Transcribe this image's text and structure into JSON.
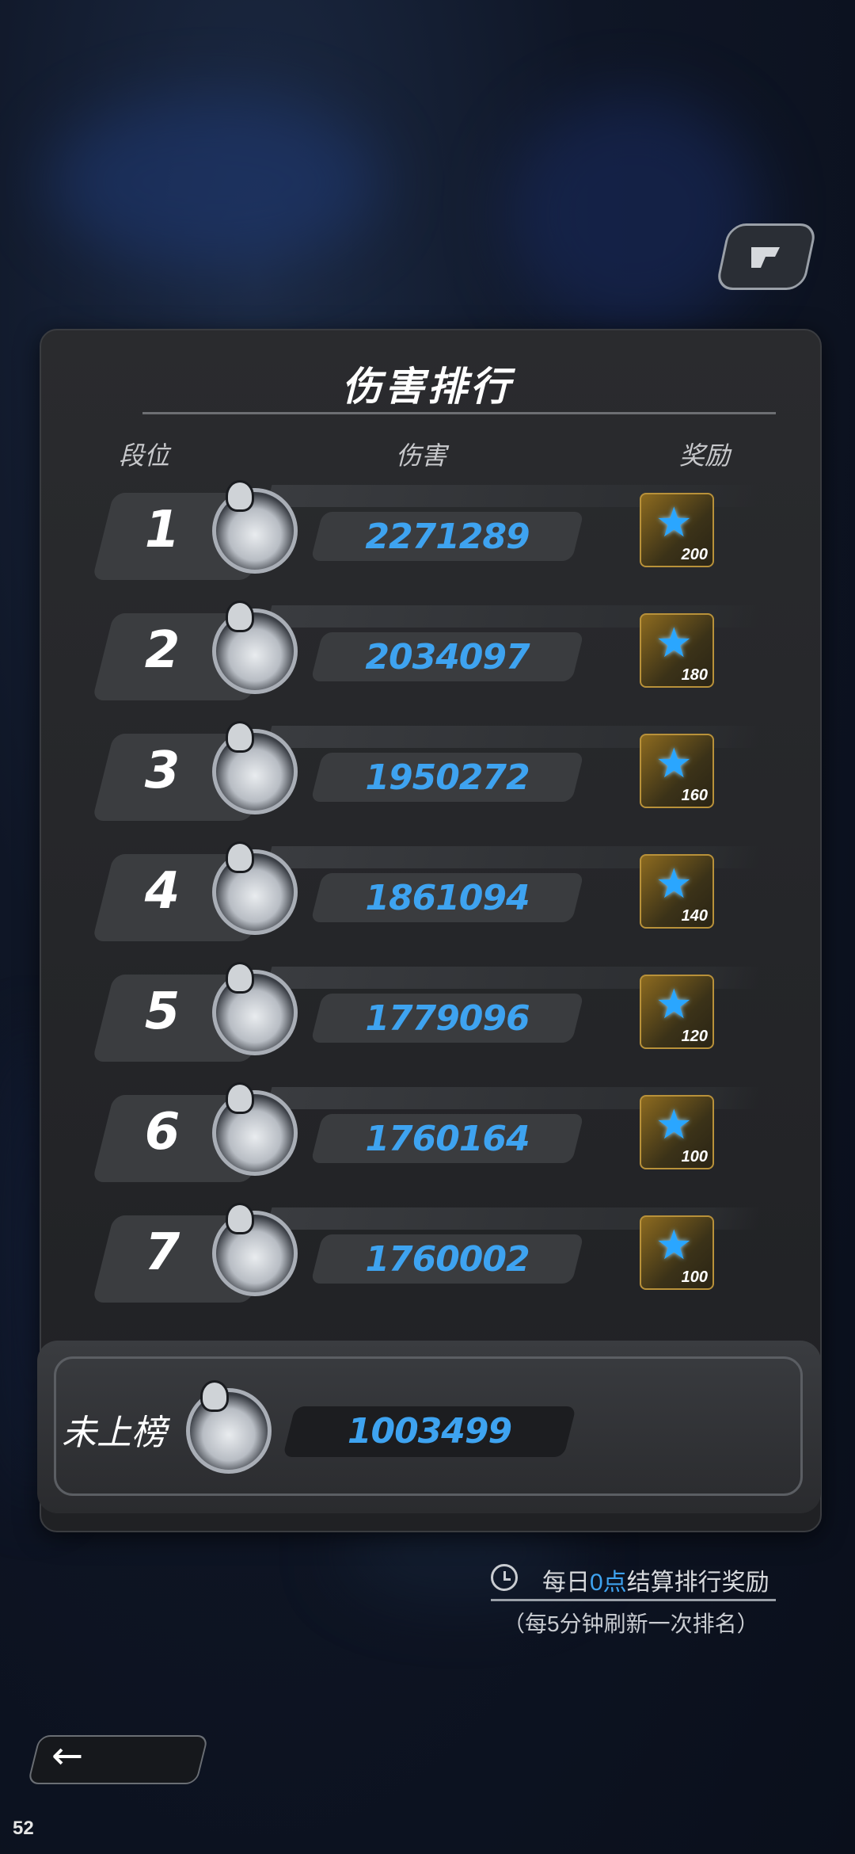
{
  "screen": {
    "title": "伤害排行",
    "fps": "52"
  },
  "columns": {
    "rank": "段位",
    "damage": "伤害",
    "reward": "奖励"
  },
  "rows": [
    {
      "rank": "1",
      "damage": "2271289",
      "reward": "200"
    },
    {
      "rank": "2",
      "damage": "2034097",
      "reward": "180"
    },
    {
      "rank": "3",
      "damage": "1950272",
      "reward": "160"
    },
    {
      "rank": "4",
      "damage": "1861094",
      "reward": "140"
    },
    {
      "rank": "5",
      "damage": "1779096",
      "reward": "120"
    },
    {
      "rank": "6",
      "damage": "1760164",
      "reward": "100"
    },
    {
      "rank": "7",
      "damage": "1760002",
      "reward": "100"
    }
  ],
  "self": {
    "label": "未上榜",
    "damage": "1003499"
  },
  "info": {
    "line1_prefix": "每日",
    "line1_highlight": "0点",
    "line1_suffix": "结算排行奖励",
    "line2": "（每5分钟刷新一次排名）"
  },
  "icons": {
    "share": "share-icon",
    "reward": "star-icon",
    "clock": "clock-icon",
    "back": "back-arrow-icon"
  },
  "colors": {
    "accent": "#3ea3f0",
    "panel": "#262729"
  }
}
